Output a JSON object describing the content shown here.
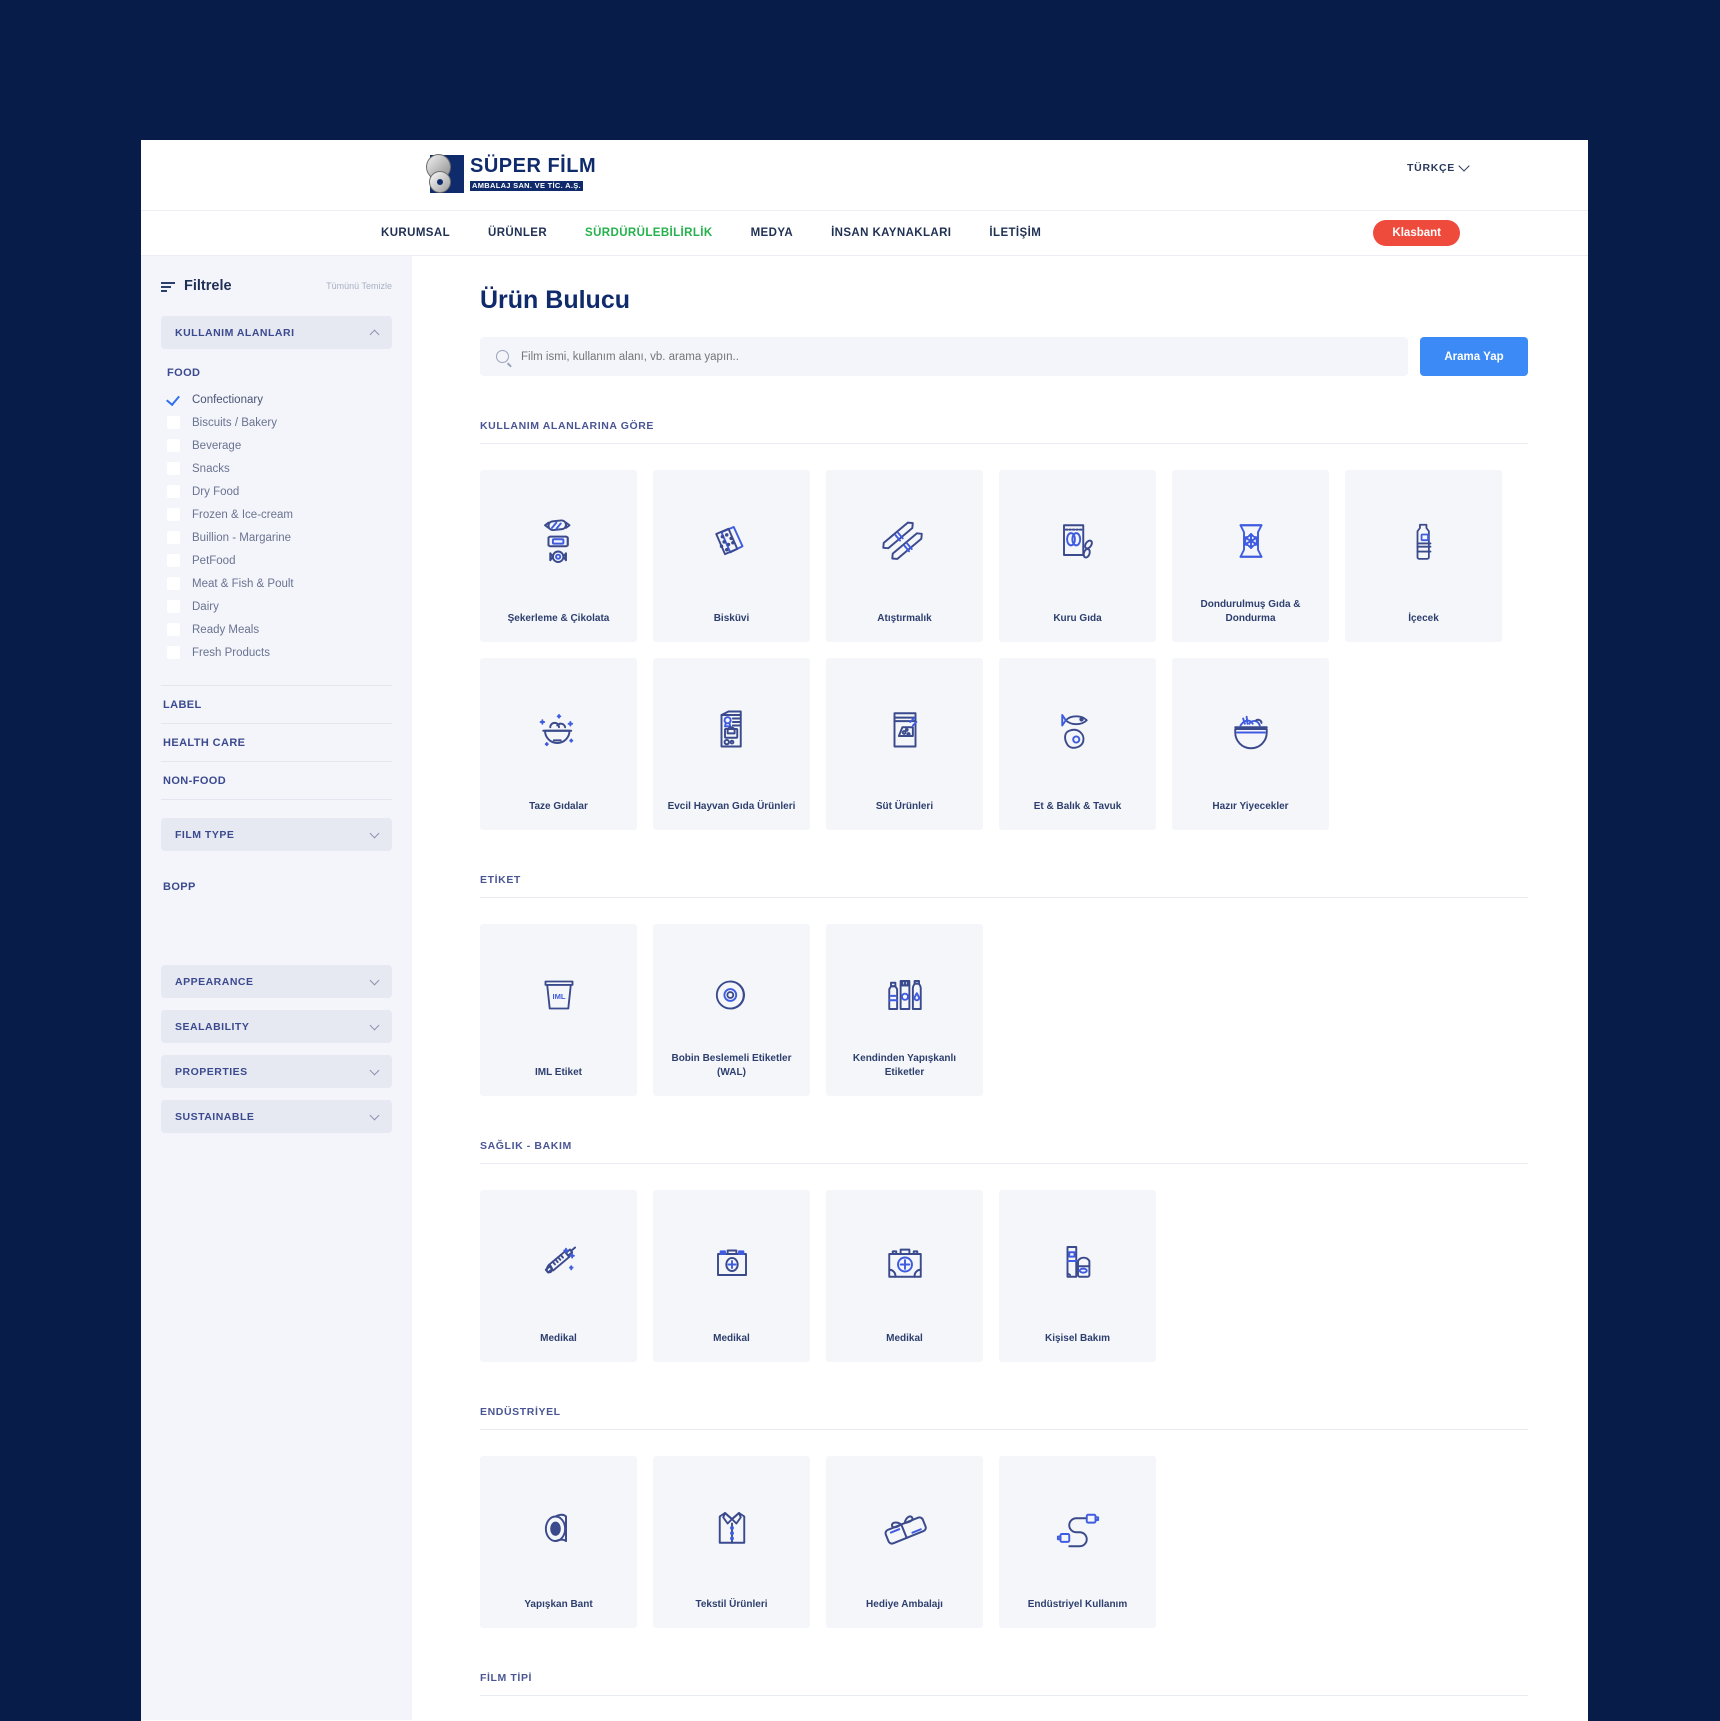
{
  "header": {
    "logo_line1": "SÜPER FİLM",
    "logo_line2": "AMBALAJ SAN. VE TİC. A.Ş.",
    "language": "TÜRKÇE",
    "cta_label": "Klasbant",
    "nav": [
      {
        "label": "KURUMSAL",
        "active": false
      },
      {
        "label": "ÜRÜNLER",
        "active": false
      },
      {
        "label": "SÜRDÜRÜLEBİLİRLİK",
        "active": true
      },
      {
        "label": "MEDYA",
        "active": false
      },
      {
        "label": "İNSAN KAYNAKLARI",
        "active": false
      },
      {
        "label": "İLETİŞİM",
        "active": false
      }
    ]
  },
  "sidebar": {
    "title": "Filtrele",
    "clear_all": "Tümünü Temizle",
    "accordion_usage": "KULLANIM ALANLARI",
    "group_food": "FOOD",
    "food_items": [
      {
        "label": "Confectionary",
        "checked": true
      },
      {
        "label": "Biscuits / Bakery",
        "checked": false
      },
      {
        "label": "Beverage",
        "checked": false
      },
      {
        "label": "Snacks",
        "checked": false
      },
      {
        "label": "Dry Food",
        "checked": false
      },
      {
        "label": "Frozen & Ice-cream",
        "checked": false
      },
      {
        "label": "Buillion - Margarine",
        "checked": false
      },
      {
        "label": "PetFood",
        "checked": false
      },
      {
        "label": "Meat & Fish & Poult",
        "checked": false
      },
      {
        "label": "Dairy",
        "checked": false
      },
      {
        "label": "Ready Meals",
        "checked": false
      },
      {
        "label": "Fresh Products",
        "checked": false
      }
    ],
    "plain_sections": [
      "LABEL",
      "HEALTH CARE",
      "NON-FOOD"
    ],
    "accordion_filmtype": "FILM TYPE",
    "filmtype_item": "BOPP",
    "accordions_bottom": [
      "APPEARANCE",
      "SEALABILITY",
      "PROPERTIES",
      "SUSTAINABLE"
    ]
  },
  "main": {
    "page_title": "Ürün Bulucu",
    "search_placeholder": "Film ismi, kullanım alanı, vb. arama yapın..",
    "search_value": "",
    "search_button": "Arama Yap",
    "sections": [
      {
        "heading": "KULLANIM ALANLARINA GÖRE",
        "cards": [
          {
            "label": "Şekerleme & Çikolata",
            "icon": "candy-icon"
          },
          {
            "label": "Bisküvi",
            "icon": "biscuit-icon"
          },
          {
            "label": "Atıştırmalık",
            "icon": "snack-bar-icon"
          },
          {
            "label": "Kuru Gıda",
            "icon": "dry-food-bag-icon"
          },
          {
            "label": "Dondurulmuş Gıda & Dondurma",
            "icon": "frozen-bag-icon"
          },
          {
            "label": "İçecek",
            "icon": "bottle-icon"
          },
          {
            "label": "Taze Gıdalar",
            "icon": "fresh-bowl-icon"
          },
          {
            "label": "Evcil Hayvan Gıda Ürünleri",
            "icon": "petfood-bag-icon"
          },
          {
            "label": "Süt Ürünleri",
            "icon": "cheese-pack-icon"
          },
          {
            "label": "Et & Balık & Tavuk",
            "icon": "fish-meat-icon"
          },
          {
            "label": "Hazır Yiyecekler",
            "icon": "ready-meal-tray-icon"
          }
        ]
      },
      {
        "heading": "ETİKET",
        "cards": [
          {
            "label": "IML Etiket",
            "icon": "iml-tub-icon"
          },
          {
            "label": "Bobin Beslemeli Etiketler (WAL)",
            "icon": "reel-icon"
          },
          {
            "label": "Kendinden Yapışkanlı Etiketler",
            "icon": "bottles-icon"
          }
        ]
      },
      {
        "heading": "SAĞLIK - BAKIM",
        "cards": [
          {
            "label": "Medikal",
            "icon": "syringe-icon"
          },
          {
            "label": "Medikal",
            "icon": "first-aid-box-icon"
          },
          {
            "label": "Medikal",
            "icon": "medical-case-icon"
          },
          {
            "label": "Kişisel Bakım",
            "icon": "cosmetics-icon"
          }
        ]
      },
      {
        "heading": "ENDÜSTRİYEL",
        "cards": [
          {
            "label": "Yapışkan Bant",
            "icon": "tape-roll-icon"
          },
          {
            "label": "Tekstil Ürünleri",
            "icon": "shirt-icon"
          },
          {
            "label": "Hediye Ambalajı",
            "icon": "gift-wrap-icon"
          },
          {
            "label": "Endüstriyel Kullanım",
            "icon": "cable-icon"
          }
        ]
      },
      {
        "heading": "FİLM TİPİ",
        "cards": []
      }
    ]
  },
  "colors": {
    "page_background": "#071c49",
    "accent_blue": "#3b8af5",
    "cta_red": "#ef4b3c",
    "nav_active_green": "#25b14c",
    "icon_navy": "#3a4a8c",
    "icon_blue": "#3f5ce0"
  }
}
